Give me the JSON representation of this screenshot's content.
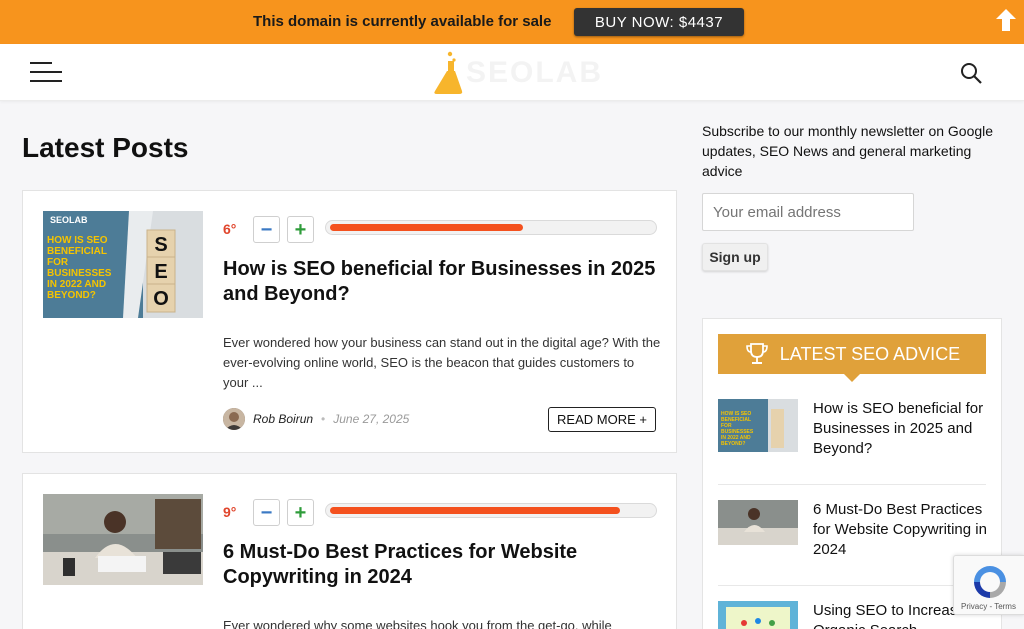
{
  "sale_bar": {
    "message": "This domain is currently available for sale",
    "buy_label": "BUY NOW: $4437",
    "bg_color": "#f7941d"
  },
  "header": {
    "logo_text": "SEOLAB",
    "menu_icon": "hamburger-icon",
    "search_icon": "search-icon"
  },
  "main": {
    "title": "Latest Posts",
    "posts": [
      {
        "score": "6°",
        "vote_fraction": 0.6,
        "thumb_text": "HOW IS SEO BENEFICIAL FOR BUSINESSES IN 2022 AND BEYOND?",
        "thumb_logo": "SEOLAB",
        "thumb_cubes": [
          "S",
          "E",
          "O"
        ],
        "title": "How is SEO beneficial for Businesses in 2025 and Beyond?",
        "excerpt": "Ever wondered how your business can stand out in the digital age? With the ever-evolving online world, SEO is the beacon that guides customers to your ...",
        "author": "Rob Boirun",
        "date": "June 27, 2025",
        "read_more": "READ MORE +"
      },
      {
        "score": "9°",
        "vote_fraction": 0.9,
        "title": "6 Must-Do Best Practices for Website Copywriting in 2024",
        "excerpt": "Ever wondered why some websites hook you from the get-go, while"
      }
    ]
  },
  "sidebar": {
    "newsletter_text": "Subscribe to our monthly newsletter on Google updates, SEO News and general marketing advice",
    "email_placeholder": "Your email address",
    "signup_label": "Sign up",
    "widget_title": "LATEST SEO ADVICE",
    "widget_color": "#e0a13a",
    "items": [
      {
        "title": "How is SEO beneficial for Businesses in 2025 and Beyond?"
      },
      {
        "title": "6 Must-Do Best Practices for Website Copywriting in 2024"
      },
      {
        "title": "Using SEO to Increase Organic Search"
      }
    ]
  },
  "recaptcha": {
    "links": "Privacy - Terms"
  }
}
